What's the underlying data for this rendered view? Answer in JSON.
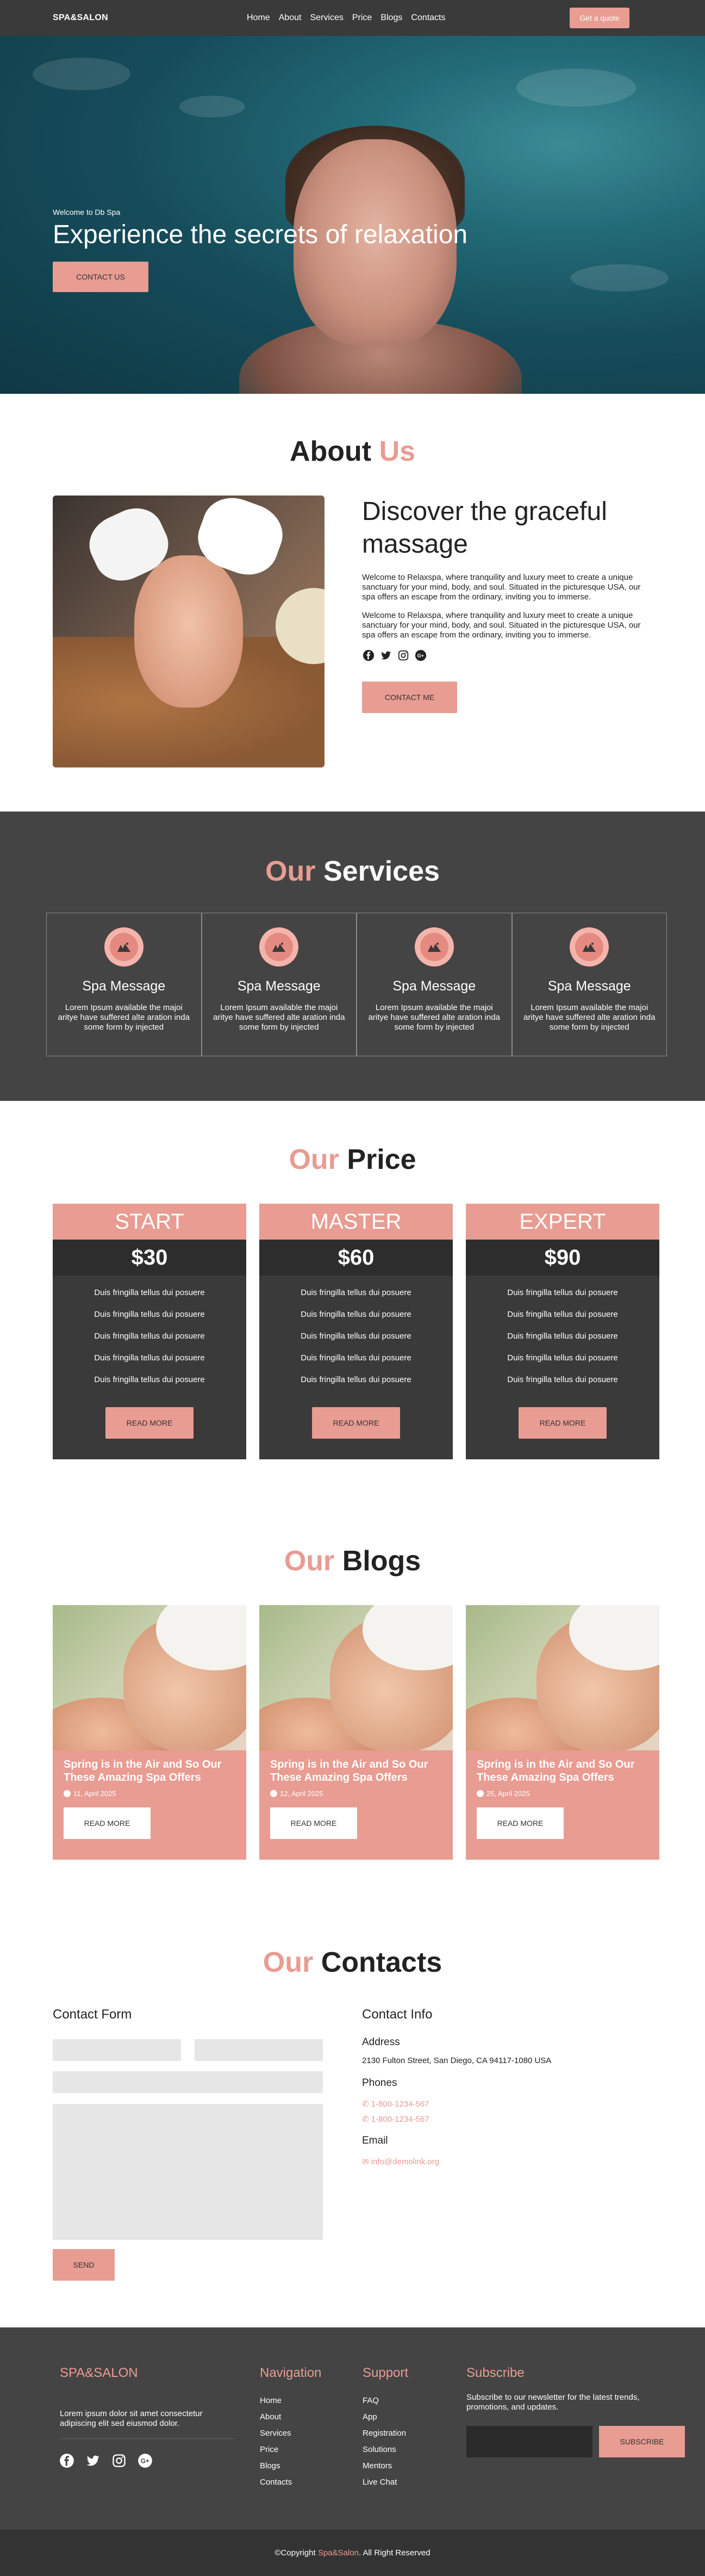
{
  "nav": {
    "brand": "SPA&SALON",
    "links": [
      "Home",
      "About",
      "Services",
      "Price",
      "Blogs",
      "Contacts"
    ],
    "quote_label": "Get a quote"
  },
  "hero": {
    "subtitle": "Welcome to Db Spa",
    "title": "Experience the secrets of relaxation",
    "cta": "CONTACT US"
  },
  "about": {
    "title_accent": "About",
    "title_main": "Us",
    "heading": "Discover the graceful massage",
    "paragraphs": [
      "Welcome to Relaxspa, where tranquility and luxury meet to create a unique sanctuary for your mind, body, and soul. Situated in the picturesque USA, our spa offers an escape from the ordinary, inviting you to immerse.",
      "Welcome to Relaxspa, where tranquility and luxury meet to create a unique sanctuary for your mind, body, and soul. Situated in the picturesque USA, our spa offers an escape from the ordinary, inviting you to immerse."
    ],
    "social_icons": [
      "facebook-icon",
      "twitter-icon",
      "instagram-icon",
      "google-plus-icon"
    ],
    "cta": "CONTACT ME"
  },
  "services": {
    "title_accent": "Our",
    "title_main": "Services",
    "items": [
      {
        "title": "Spa Message",
        "text": "Lorem Ipsum available the majoi arityе have suffered alte aration inda some form by injected"
      },
      {
        "title": "Spa Message",
        "text": "Lorem Ipsum available the majoi arityе have suffered alte aration inda some form by injected"
      },
      {
        "title": "Spa Message",
        "text": "Lorem Ipsum available the majoi arityе have suffered alte aration inda some form by injected"
      },
      {
        "title": "Spa Message",
        "text": "Lorem Ipsum available the majoi arityе have suffered alte aration inda some form by injected"
      }
    ]
  },
  "price": {
    "title_accent": "Our",
    "title_main": "Price",
    "plans": [
      {
        "name": "START",
        "amount": "$30",
        "features": [
          "Duis fringilla tellus dui posuere",
          "Duis fringilla tellus dui posuere",
          "Duis fringilla tellus dui posuere",
          "Duis fringilla tellus dui posuere",
          "Duis fringilla tellus dui posuere"
        ],
        "button": "READ MORE"
      },
      {
        "name": "MASTER",
        "amount": "$60",
        "features": [
          "Duis fringilla tellus dui posuere",
          "Duis fringilla tellus dui posuere",
          "Duis fringilla tellus dui posuere",
          "Duis fringilla tellus dui posuere",
          "Duis fringilla tellus dui posuere"
        ],
        "button": "READ MORE"
      },
      {
        "name": "EXPERT",
        "amount": "$90",
        "features": [
          "Duis fringilla tellus dui posuere",
          "Duis fringilla tellus dui posuere",
          "Duis fringilla tellus dui posuere",
          "Duis fringilla tellus dui posuere",
          "Duis fringilla tellus dui posuere"
        ],
        "button": "READ MORE"
      }
    ]
  },
  "blogs": {
    "title_accent": "Our",
    "title_main": "Blogs",
    "posts": [
      {
        "title": "Spring is in the Air and So Our These Amazing Spa Offers",
        "date": "11, April 2025",
        "button": "READ MORE"
      },
      {
        "title": "Spring is in the Air and So Our These Amazing Spa Offers",
        "date": "12, April 2025",
        "button": "READ MORE"
      },
      {
        "title": "Spring is in the Air and So Our These Amazing Spa Offers",
        "date": "25, April 2025",
        "button": "READ MORE"
      }
    ]
  },
  "contacts": {
    "title_accent": "Our",
    "title_main": "Contacts",
    "form_title": "Contact Form",
    "send": "SEND",
    "info_title": "Contact Info",
    "address_label": "Address",
    "address": "2130 Fulton Street, San Diego, CA 94117-1080 USA",
    "phones_label": "Phones",
    "phones": [
      "1-800-1234-567",
      "1-800-1234-567"
    ],
    "email_label": "Email",
    "email": "info@demolink.org"
  },
  "footer": {
    "brand": "SPA&SALON",
    "brand_text": "Lorem ipsum dolor sit amet consectetur adipiscing elit sed eiusmod dolor.",
    "social_icons": [
      "facebook-icon",
      "twitter-icon",
      "instagram-icon",
      "google-plus-icon"
    ],
    "nav_title": "Navigation",
    "nav_links": [
      "Home",
      "About",
      "Services",
      "Price",
      "Blogs",
      "Contacts"
    ],
    "support_title": "Support",
    "support_links": [
      "FAQ",
      "App",
      "Registration",
      "Solutions",
      "Mentors",
      "Live Chat"
    ],
    "subscribe_title": "Subscribe",
    "subscribe_text": "Subscribe to our newsletter for the latest trends, promotions, and updates.",
    "subscribe_button": "SUBSCRIBE",
    "copyright_prefix": "©Copyright",
    "copyright_brand": "Spa&Salon",
    "copyright_suffix": ". All Right Reserved"
  }
}
